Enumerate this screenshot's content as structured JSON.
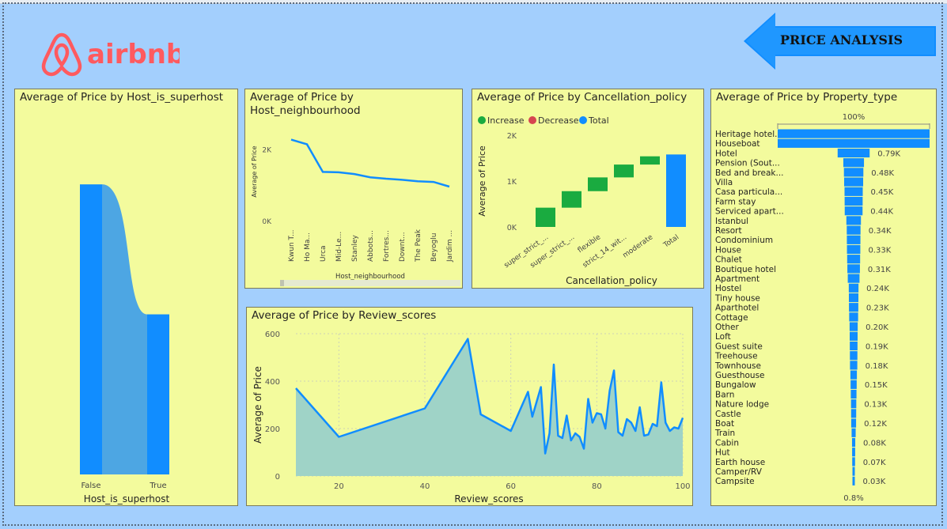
{
  "header": {
    "logo_text": "airbnb",
    "banner_title": "PRICE ANALYSIS"
  },
  "colors": {
    "accent": "#118dff",
    "brand": "#ff5a5f",
    "panel_bg": "#f3fb9d",
    "page_bg": "#a3cffd",
    "increase": "#1aab40",
    "decrease": "#d64550"
  },
  "panels": {
    "superhost": {
      "title": "Average of Price by Host_is_superhost"
    },
    "neighbourhood": {
      "title": "Average of Price by Host_neighbourhood"
    },
    "cancellation": {
      "title": "Average of Price by Cancellation_policy"
    },
    "review": {
      "title": "Average of Price by Review_scores"
    },
    "property": {
      "title": "Average of Price by Property_type"
    }
  },
  "chart_data": [
    {
      "id": "superhost",
      "type": "ribbon",
      "title": "Average of Price by Host_is_superhost",
      "xlabel": "Host_is_superhost",
      "categories": [
        "False",
        "True"
      ],
      "values": [
        1830,
        1010
      ],
      "ylim": [
        0,
        2200
      ]
    },
    {
      "id": "neighbourhood",
      "type": "line",
      "title": "Average of Price by Host_neighbourhood",
      "xlabel": "Host_neighbourhood",
      "ylabel": "Average of Price",
      "categories": [
        "Kwun T...",
        "Ho Ma...",
        "Urca",
        "Mid-Le...",
        "Stanley",
        "Abbots...",
        "Fortres...",
        "Downt...",
        "The Peak",
        "Beyoglu",
        "Jardim ..."
      ],
      "values": [
        2280,
        2150,
        1380,
        1370,
        1320,
        1230,
        1190,
        1160,
        1120,
        1100,
        970
      ],
      "ylim": [
        0,
        2800
      ],
      "yticks": [
        "0K",
        "2K"
      ]
    },
    {
      "id": "cancellation",
      "type": "waterfall",
      "title": "Average of Price by Cancellation_policy",
      "xlabel": "Cancellation_policy",
      "ylabel": "Average of Price",
      "legend": [
        "Increase",
        "Decrease",
        "Total"
      ],
      "categories": [
        "super_strict_...",
        "super_strict_...",
        "flexible",
        "strict_14_wit...",
        "moderate",
        "Total"
      ],
      "values": [
        420,
        360,
        300,
        280,
        180,
        1580
      ],
      "ylim": [
        0,
        2000
      ],
      "yticks": [
        "0K",
        "1K",
        "2K"
      ]
    },
    {
      "id": "review",
      "type": "area",
      "title": "Average of Price by Review_scores",
      "xlabel": "Review_scores",
      "ylabel": "Average of Price",
      "x": [
        10,
        20,
        40,
        50,
        53,
        60,
        64,
        65,
        67,
        68,
        69,
        70,
        71,
        72,
        73,
        74,
        75,
        76,
        77,
        78,
        79,
        80,
        81,
        82,
        83,
        84,
        85,
        86,
        87,
        88,
        89,
        90,
        91,
        92,
        93,
        94,
        95,
        96,
        97,
        98,
        99,
        100
      ],
      "values": [
        370,
        165,
        285,
        578,
        260,
        190,
        355,
        250,
        375,
        95,
        180,
        470,
        170,
        160,
        255,
        150,
        180,
        165,
        115,
        325,
        225,
        265,
        260,
        200,
        360,
        445,
        185,
        170,
        240,
        225,
        190,
        290,
        170,
        175,
        220,
        210,
        395,
        225,
        190,
        205,
        200,
        245
      ],
      "xlim": [
        10,
        100
      ],
      "ylim": [
        0,
        600
      ],
      "xticks": [
        20,
        40,
        60,
        80,
        100
      ],
      "yticks": [
        0,
        200,
        400,
        600
      ]
    },
    {
      "id": "property",
      "type": "bar",
      "orientation": "horizontal-funnel",
      "title": "Average of Price by Property_type",
      "top_label": "100%",
      "bottom_label": "0.8%",
      "categories": [
        "Heritage hotel...",
        "Houseboat",
        "Hotel",
        "Pension (Sout...",
        "Bed and break...",
        "Villa",
        "Casa particula...",
        "Farm stay",
        "Serviced apart...",
        "Istanbul",
        "Resort",
        "Condominium",
        "House",
        "Chalet",
        "Boutique hotel",
        "Apartment",
        "Hostel",
        "Tiny house",
        "Aparthotel",
        "Cottage",
        "Other",
        "Loft",
        "Guest suite",
        "Treehouse",
        "Townhouse",
        "Guesthouse",
        "Bungalow",
        "Barn",
        "Nature lodge",
        "Castle",
        "Boat",
        "Train",
        "Cabin",
        "Hut",
        "Earth house",
        "Camper/RV",
        "Campsite"
      ],
      "values": [
        3750,
        3750,
        790,
        510,
        480,
        470,
        450,
        445,
        440,
        360,
        340,
        335,
        330,
        320,
        310,
        290,
        240,
        235,
        230,
        220,
        200,
        195,
        190,
        185,
        180,
        160,
        150,
        140,
        130,
        125,
        120,
        100,
        80,
        75,
        70,
        50,
        30
      ],
      "data_labels": {
        "2": "0.79K",
        "4": "0.48K",
        "6": "0.45K",
        "8": "0.44K",
        "10": "0.34K",
        "12": "0.33K",
        "14": "0.31K",
        "16": "0.24K",
        "18": "0.23K",
        "20": "0.20K",
        "22": "0.19K",
        "24": "0.18K",
        "26": "0.15K",
        "28": "0.13K",
        "30": "0.12K",
        "32": "0.08K",
        "34": "0.07K",
        "36": "0.03K"
      }
    }
  ]
}
